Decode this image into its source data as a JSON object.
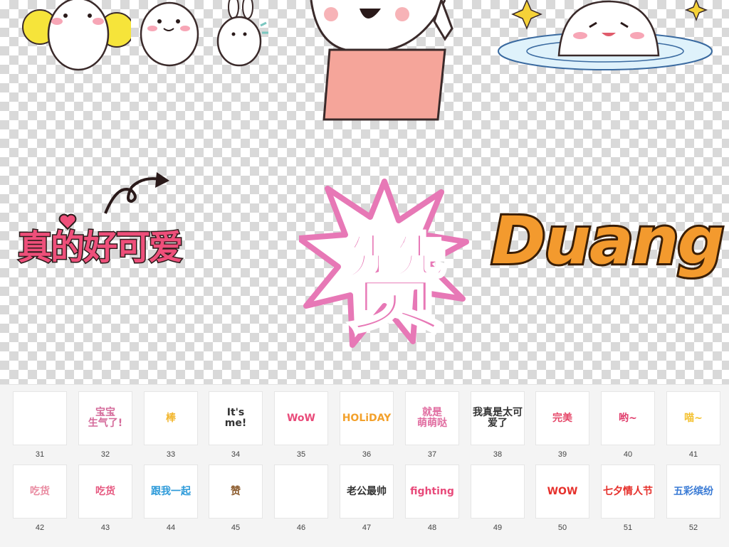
{
  "preview": {
    "headline_left": "真的好可爱",
    "headline_center": "赞",
    "headline_right": "Duang"
  },
  "thumbnails": [
    [
      {
        "num": "31",
        "art": "",
        "color": "#c85a3a"
      },
      {
        "num": "32",
        "art": "宝宝\n生气了!",
        "color": "#d46a9a"
      },
      {
        "num": "33",
        "art": "棒",
        "color": "#f2b62d"
      },
      {
        "num": "34",
        "art": "It's\nme!",
        "color": "#333333"
      },
      {
        "num": "35",
        "art": "WoW",
        "color": "#e94b7a"
      },
      {
        "num": "36",
        "art": "HOLiDAY",
        "color": "#f3a12c"
      },
      {
        "num": "37",
        "art": "就是\n萌萌哒",
        "color": "#e06ca0"
      },
      {
        "num": "38",
        "art": "我真是太可爱了",
        "color": "#333333"
      },
      {
        "num": "39",
        "art": "完美",
        "color": "#e64a6b"
      },
      {
        "num": "40",
        "art": "哟~",
        "color": "#e03c6b"
      },
      {
        "num": "41",
        "art": "喵~",
        "color": "#f4c130"
      }
    ],
    [
      {
        "num": "42",
        "art": "吃货",
        "color": "#e98aa0"
      },
      {
        "num": "43",
        "art": "吃货",
        "color": "#e6577f"
      },
      {
        "num": "44",
        "art": "跟我一起",
        "color": "#2d9ad9"
      },
      {
        "num": "45",
        "art": "赞",
        "color": "#8b5a2b"
      },
      {
        "num": "46",
        "art": "",
        "color": "#333333"
      },
      {
        "num": "47",
        "art": "老公最帅",
        "color": "#333333"
      },
      {
        "num": "48",
        "art": "fighting",
        "color": "#e84a7a"
      },
      {
        "num": "49",
        "art": "",
        "color": "#e98aa0"
      },
      {
        "num": "50",
        "art": "WOW",
        "color": "#e6312c"
      },
      {
        "num": "51",
        "art": "七夕情人节",
        "color": "#e6312c"
      },
      {
        "num": "52",
        "art": "五彩缤纷",
        "color": "#3a7bd5"
      }
    ]
  ]
}
